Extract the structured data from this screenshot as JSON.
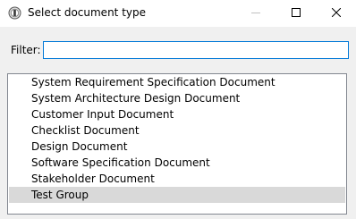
{
  "window": {
    "title": "Select document type",
    "icon": "app-info-icon",
    "controls": {
      "minimize": "minimize-icon",
      "maximize": "maximize-icon",
      "close": "close-icon"
    }
  },
  "filter": {
    "label": "Filter:",
    "value": "",
    "placeholder": ""
  },
  "documents": {
    "items": [
      {
        "label": "System Requirement Specification Document",
        "selected": false
      },
      {
        "label": "System Architecture Design Document",
        "selected": false
      },
      {
        "label": "Customer Input Document",
        "selected": false
      },
      {
        "label": "Checklist Document",
        "selected": false
      },
      {
        "label": "Design Document",
        "selected": false
      },
      {
        "label": "Software Specification Document",
        "selected": false
      },
      {
        "label": "Stakeholder Document",
        "selected": false
      },
      {
        "label": "Test Group",
        "selected": true
      }
    ]
  },
  "colors": {
    "accent": "#0078d7",
    "selection": "#d9d9d9",
    "dialog_background": "#f0f0f0"
  }
}
